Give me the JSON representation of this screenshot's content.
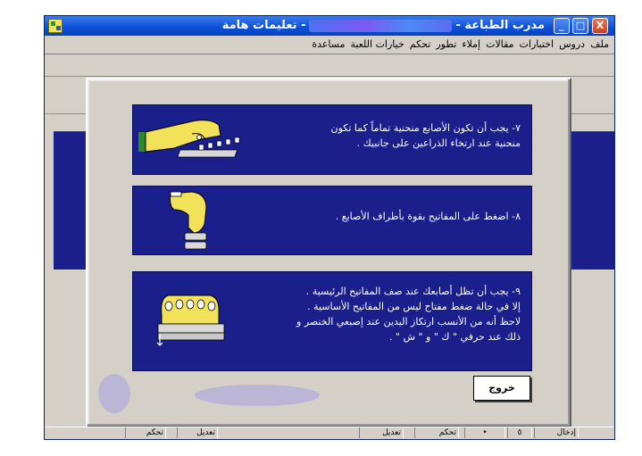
{
  "window": {
    "title_main": "مدرب الطباعة -",
    "title_sub": "- تعليمات هامة",
    "controls": {
      "minimize": "_",
      "maximize": "□",
      "close": "X"
    }
  },
  "menu": [
    "ملف",
    "دروس",
    "اختبارات",
    "مقالات",
    "إملاء",
    "تطور",
    "تحكم",
    "خيارات اللعبة",
    "مساعدة"
  ],
  "cards": [
    {
      "lines": [
        "٧- يجب أن تكون الأصابع منحنية تماماً كما تكون",
        "منحنية عند ارتخاء الذراعين على جانبيك ."
      ]
    },
    {
      "lines": [
        "٨- اضغط على المفاتيح بقوة بأطراف الأصابع ."
      ]
    },
    {
      "lines": [
        "٩- يجب أن تظل أصابعك عند صف المفاتيح الرئيسية .",
        "إلا في حالة ضغط مفتاح ليس من المفاتيح الأساسية .",
        "لاحظ أنه من الأنسب ارتكاز اليدين عند إصبعي الخنصر و",
        "ذلك عند حرفي \" ك \" و \" ش \" ."
      ]
    }
  ],
  "exit_button": "خروج",
  "status_bar": [
    "إدخال",
    "٥",
    "•",
    "تحكم",
    "تعديل",
    "تعديل",
    "تحكم"
  ],
  "colors": {
    "card_bg": "#1a1f8c",
    "title_bar": "#0a4fd8",
    "chrome": "#d4d0c8"
  }
}
